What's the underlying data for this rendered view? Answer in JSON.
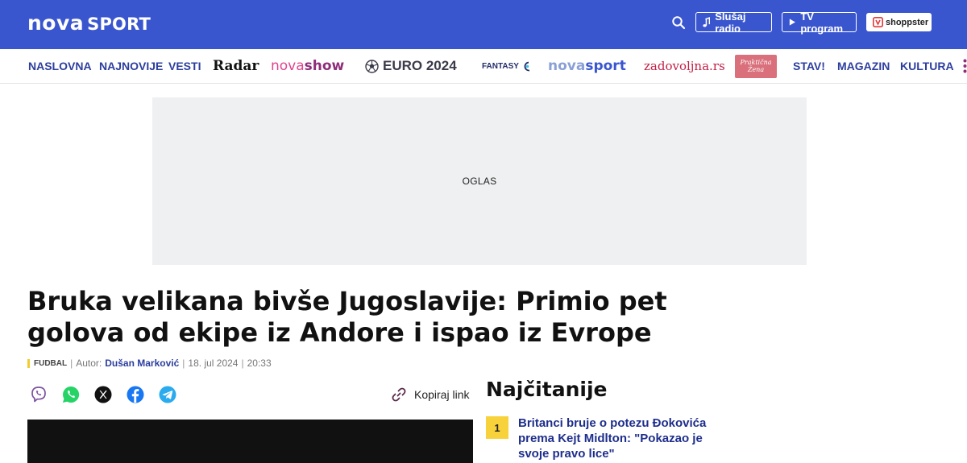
{
  "header": {
    "logo_nova": "nova",
    "logo_sport": "SPORT",
    "radio_label": "Slušaj radio",
    "tv_label": "TV program",
    "shop_label": "shoppster"
  },
  "nav": {
    "naslovna": "NASLOVNA",
    "najnovije": "NAJNOVIJE",
    "vesti": "VESTI",
    "radar": "Radar",
    "novashow_a": "nova",
    "novashow_b": "show",
    "euro": "EURO 2024",
    "fantasy": "FANTASY",
    "novasport_a": "nova",
    "novasport_b": "sport",
    "zadovoljna": "zadovoljna.rs",
    "zona_line1": "Praktična",
    "zona_line2": "Žena",
    "stav": "STAV!",
    "magazin": "MAGAZIN",
    "kultura": "KULTURA"
  },
  "ad": {
    "label": "OGLAS"
  },
  "article": {
    "headline": "Bruka velikana bivše Jugoslavije: Primio pet golova od ekipe iz Andore i ispao iz Evrope",
    "category": "FUDBAL",
    "author_prefix": "Autor:",
    "author": "Dušan Marković",
    "date": "18. jul 2024",
    "time": "20:33",
    "copy_link": "Kopiraj link"
  },
  "sidebar": {
    "title": "Najčitanije",
    "items": [
      {
        "rank": "1",
        "title": "Britanci bruje o potezu Đokovića prema Kejt Midlton: \"Pokazao je svoje pravo lice\""
      }
    ]
  },
  "colors": {
    "header_blue": "#3a56cf",
    "nav_text": "#2c3e9e",
    "rank_yellow": "#f8d23b"
  }
}
